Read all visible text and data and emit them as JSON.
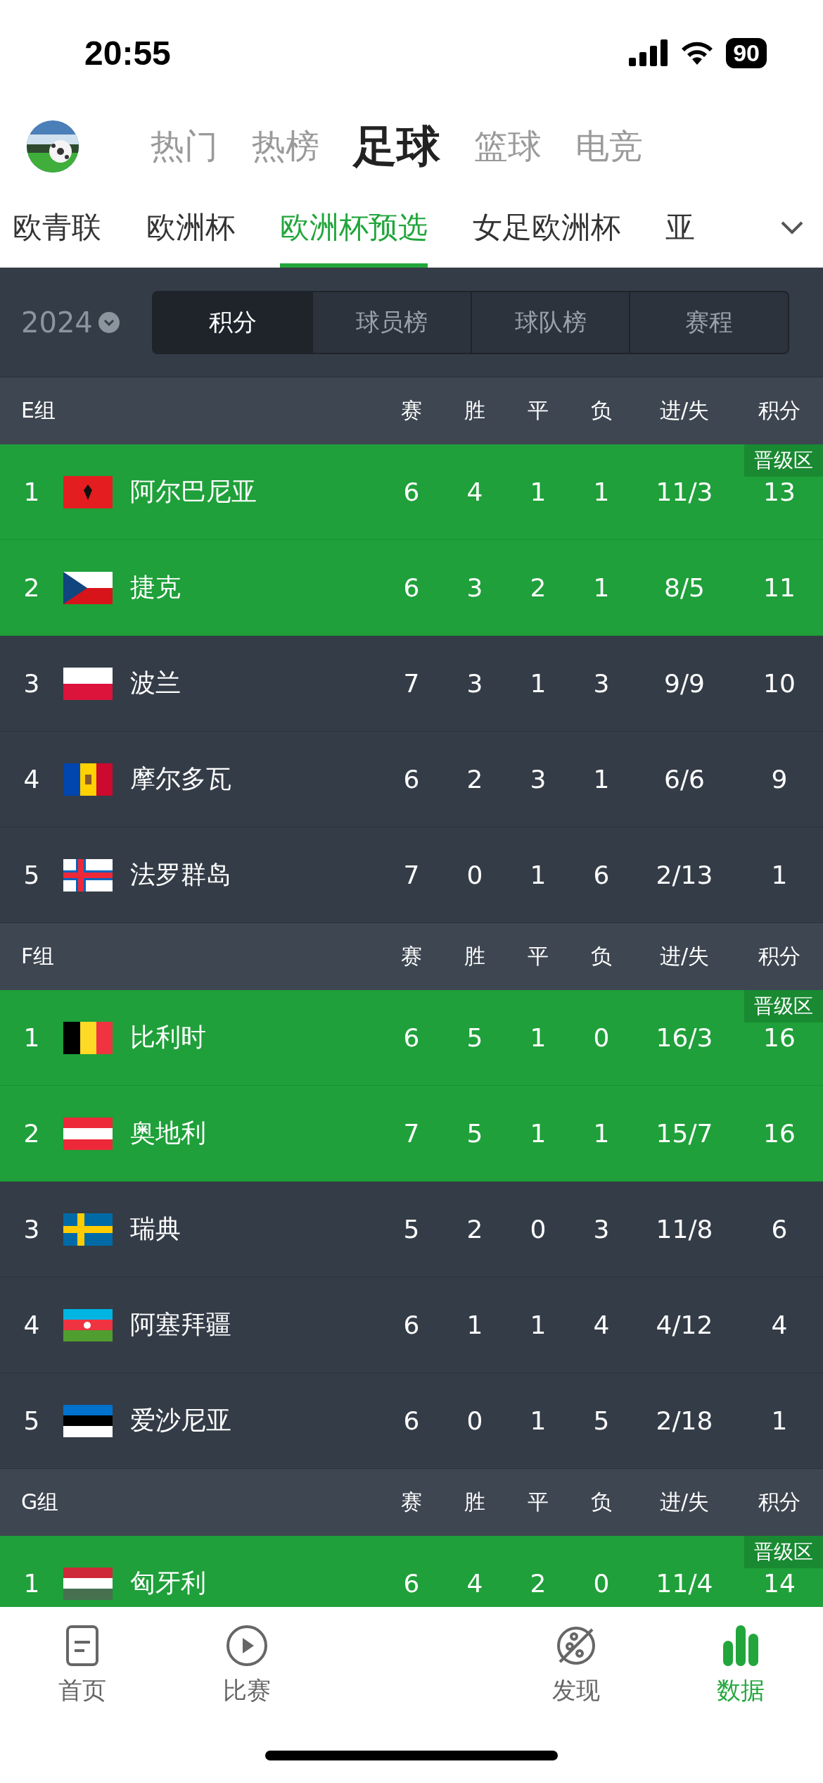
{
  "status_bar": {
    "time": "20:55",
    "battery": "90"
  },
  "top_tabs": [
    {
      "label": "热门",
      "selected": false
    },
    {
      "label": "热榜",
      "selected": false
    },
    {
      "label": "足球",
      "selected": true
    },
    {
      "label": "篮球",
      "selected": false
    },
    {
      "label": "电竞",
      "selected": false
    }
  ],
  "league_tabs": [
    {
      "label": "欧青联",
      "selected": false
    },
    {
      "label": "欧洲杯",
      "selected": false
    },
    {
      "label": "欧洲杯预选",
      "selected": true
    },
    {
      "label": "女足欧洲杯",
      "selected": false
    },
    {
      "label": "亚",
      "selected": false
    }
  ],
  "season": "2024",
  "segments": [
    {
      "label": "积分",
      "selected": true
    },
    {
      "label": "球员榜",
      "selected": false
    },
    {
      "label": "球队榜",
      "selected": false
    },
    {
      "label": "赛程",
      "selected": false
    }
  ],
  "groups": [
    {
      "name": "E组",
      "columns": [
        "赛",
        "胜",
        "平",
        "负",
        "进/失",
        "积分"
      ],
      "rows": [
        {
          "rank": "1",
          "team": "阿尔巴尼亚",
          "qualified": true,
          "badge": "晋级区",
          "values": [
            "6",
            "4",
            "1",
            "1",
            "11/3",
            "13"
          ]
        },
        {
          "rank": "2",
          "team": "捷克",
          "qualified": true,
          "values": [
            "6",
            "3",
            "2",
            "1",
            "8/5",
            "11"
          ]
        },
        {
          "rank": "3",
          "team": "波兰",
          "qualified": false,
          "values": [
            "7",
            "3",
            "1",
            "3",
            "9/9",
            "10"
          ]
        },
        {
          "rank": "4",
          "team": "摩尔多瓦",
          "qualified": false,
          "values": [
            "6",
            "2",
            "3",
            "1",
            "6/6",
            "9"
          ]
        },
        {
          "rank": "5",
          "team": "法罗群岛",
          "qualified": false,
          "values": [
            "7",
            "0",
            "1",
            "6",
            "2/13",
            "1"
          ]
        }
      ]
    },
    {
      "name": "F组",
      "columns": [
        "赛",
        "胜",
        "平",
        "负",
        "进/失",
        "积分"
      ],
      "rows": [
        {
          "rank": "1",
          "team": "比利时",
          "qualified": true,
          "badge": "晋级区",
          "values": [
            "6",
            "5",
            "1",
            "0",
            "16/3",
            "16"
          ]
        },
        {
          "rank": "2",
          "team": "奥地利",
          "qualified": true,
          "values": [
            "7",
            "5",
            "1",
            "1",
            "15/7",
            "16"
          ]
        },
        {
          "rank": "3",
          "team": "瑞典",
          "qualified": false,
          "values": [
            "5",
            "2",
            "0",
            "3",
            "11/8",
            "6"
          ]
        },
        {
          "rank": "4",
          "team": "阿塞拜疆",
          "qualified": false,
          "values": [
            "6",
            "1",
            "1",
            "4",
            "4/12",
            "4"
          ]
        },
        {
          "rank": "5",
          "team": "爱沙尼亚",
          "qualified": false,
          "values": [
            "6",
            "0",
            "1",
            "5",
            "2/18",
            "1"
          ]
        }
      ]
    },
    {
      "name": "G组",
      "columns": [
        "赛",
        "胜",
        "平",
        "负",
        "进/失",
        "积分"
      ],
      "rows": [
        {
          "rank": "1",
          "team": "匈牙利",
          "qualified": true,
          "badge": "晋级区",
          "values": [
            "6",
            "4",
            "2",
            "0",
            "11/4",
            "14"
          ]
        }
      ]
    }
  ],
  "bottom_nav": [
    {
      "label": "首页",
      "selected": false
    },
    {
      "label": "比赛",
      "selected": false
    },
    {
      "label": "发现",
      "selected": false
    },
    {
      "label": "数据",
      "selected": true
    }
  ]
}
